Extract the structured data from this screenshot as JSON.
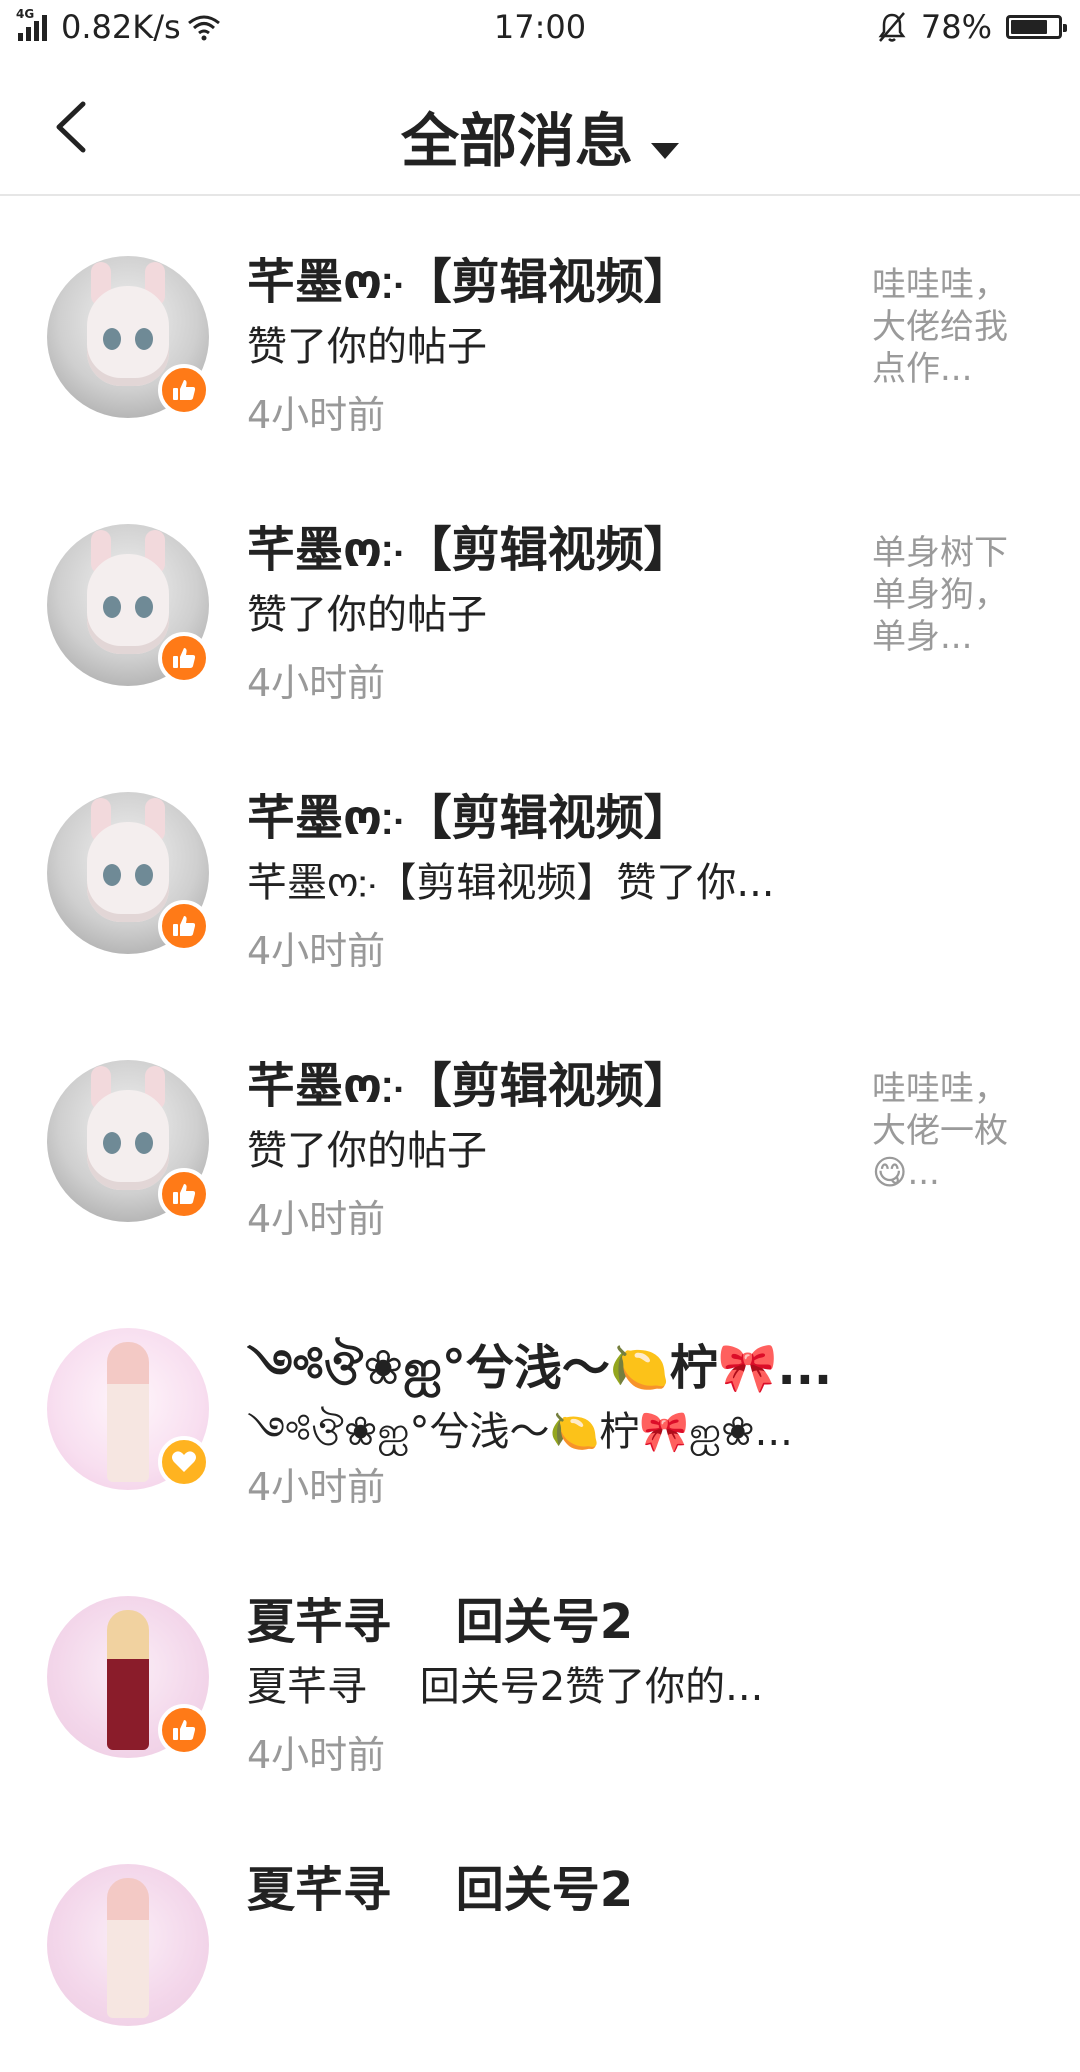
{
  "status_bar": {
    "network_type": "4G",
    "speed": "0.82K/s",
    "time": "17:00",
    "battery": "78%",
    "battery_level": 0.78
  },
  "header": {
    "title": "全部消息"
  },
  "messages": [
    {
      "name": "芊墨ო჻【剪辑视频】",
      "action": "赞了你的帖子",
      "time": "4小时前",
      "preview": "哇哇哇，大佬给我点作...",
      "badge": "thumbs-up-icon"
    },
    {
      "name": "芊墨ო჻【剪辑视频】",
      "action": "赞了你的帖子",
      "time": "4小时前",
      "preview": "单身树下单身狗，单身...",
      "badge": "thumbs-up-icon"
    },
    {
      "name": "芊墨ო჻【剪辑视频】",
      "action": "芊墨ო჻【剪辑视频】赞了你...",
      "time": "4小时前",
      "preview": "",
      "badge": "thumbs-up-icon"
    },
    {
      "name": "芊墨ო჻【剪辑视频】",
      "action": "赞了你的帖子",
      "time": "4小时前",
      "preview": "哇哇哇，大佬一枚😋...",
      "badge": "thumbs-up-icon"
    },
    {
      "name": "༺ঔ❀ஐ°兮浅～🍋柠🎀...",
      "action": "༺ঔ❀ஐ°兮浅～🍋柠🎀ஐ❀...",
      "time": "4小时前",
      "preview": "",
      "badge": "heart-icon"
    },
    {
      "name": "夏芊寻　 回关号2",
      "action": "夏芊寻　 回关号2赞了你的...",
      "time": "4小时前",
      "preview": "",
      "badge": "thumbs-up-icon"
    },
    {
      "name": "夏芊寻　 回关号2",
      "action": "",
      "time": "",
      "preview": "",
      "badge": ""
    }
  ],
  "colors": {
    "badge_like": "#ff7a17",
    "badge_heart": "#ffb320",
    "time_text": "#999999",
    "preview_text": "#9a9a9a"
  }
}
